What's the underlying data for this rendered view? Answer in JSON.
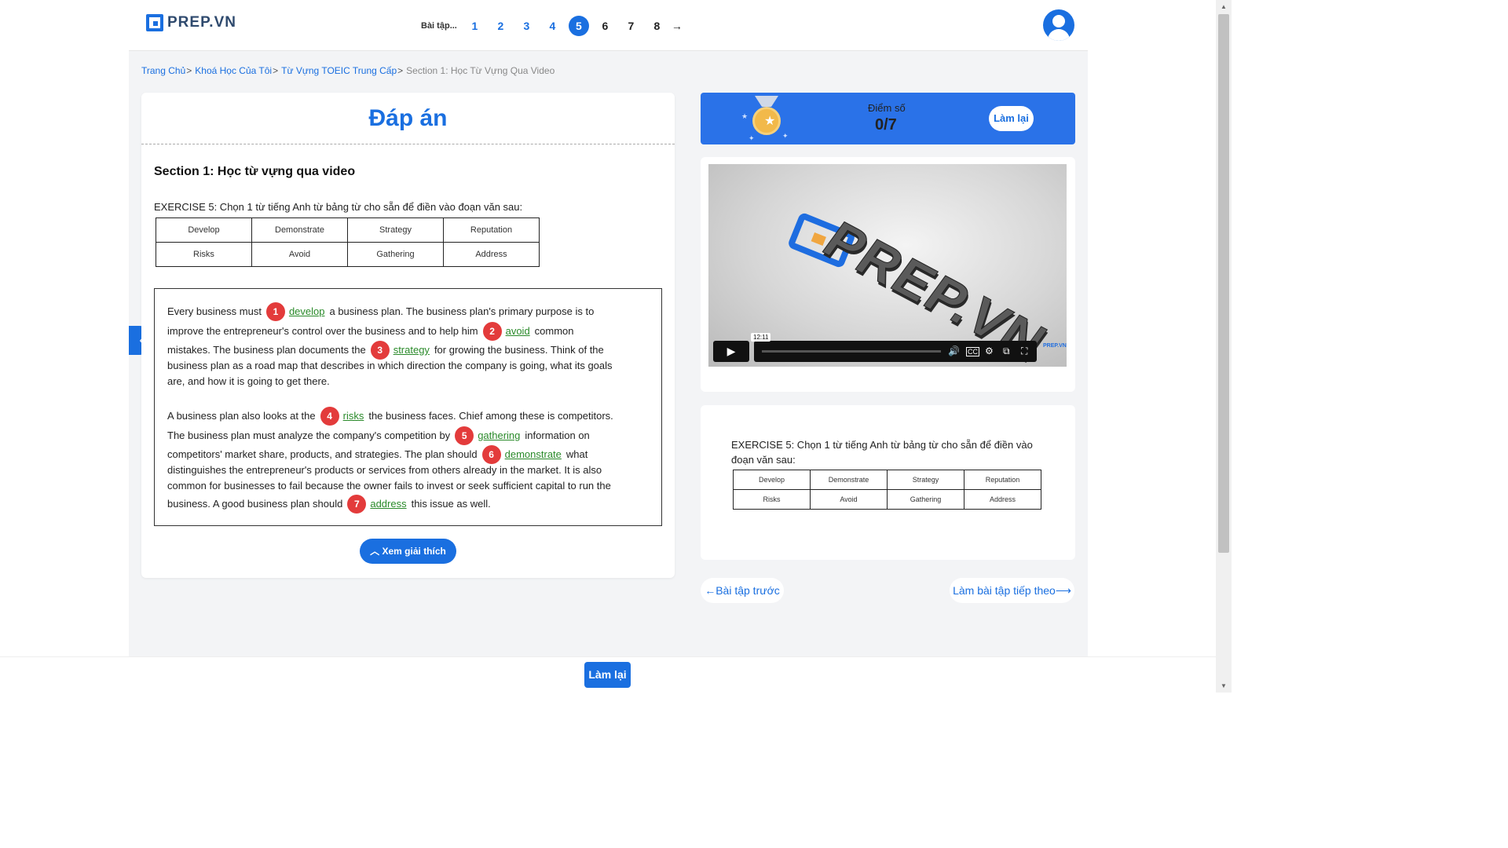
{
  "header": {
    "logo_text": "PREP.VN",
    "pager_label": "Bài tập",
    "pages": [
      "1",
      "2",
      "3",
      "4",
      "5",
      "6",
      "7",
      "8"
    ],
    "active_page": "5",
    "next_arrow": "→"
  },
  "breadcrumb": {
    "items": [
      "Trang Chủ",
      "Khoá Học Của Tôi",
      "Từ Vựng TOEIC Trung Cấp"
    ],
    "current": "Section 1: Học Từ Vựng Qua Video",
    "separator": ">"
  },
  "answer": {
    "heading": "Đáp án",
    "section_title": "Section 1: Học từ vựng qua video",
    "exercise_title": "EXERCISE 5: Chọn 1 từ tiếng Anh từ bảng từ cho sẵn để điền vào đoạn văn sau:",
    "word_table": [
      [
        "Develop",
        "Demonstrate",
        "Strategy",
        "Reputation"
      ],
      [
        "Risks",
        "Avoid",
        "Gathering",
        "Address"
      ]
    ],
    "lines": {
      "l1a": "Every business must",
      "b1": "1",
      "a1": "develop",
      "l1b": "a business plan. The business plan's primary purpose is to",
      "l2a": "improve the entrepreneur's control over the business and to help him",
      "b2": "2",
      "a2": "avoid",
      "l2b": "common",
      "l3a": "mistakes. The business plan documents the",
      "b3": "3",
      "a3": "strategy",
      "l3b": "for growing the business. Think of the",
      "l4": "business plan as a road map that describes in which direction the company is going, what its goals",
      "l5": "are, and how it is going to get there.",
      "l6a": "A business plan also looks at the",
      "b4": "4",
      "a4": "risks",
      "l6b": "the business faces. Chief among these is competitors.",
      "l7a": "The business plan must analyze the company's competition by",
      "b5": "5",
      "a5": "gathering",
      "l7b": "information on",
      "l8a": "competitors' market share, products, and strategies. The plan should",
      "b6": "6",
      "a6": "demonstrate",
      "l8b": "what",
      "l9": "distinguishes the entrepreneur's products or services from others already in the market. It is also",
      "l10": "common for businesses to fail because the owner fails to invest or seek sufficient capital to run the",
      "l11a": "business. A good business plan should",
      "b7": "7",
      "a7": "address",
      "l11b": "this issue as well."
    },
    "explain_button": "Xem giải thích"
  },
  "score": {
    "label": "Điểm số",
    "value": "0/7",
    "retry_label": "Làm lại"
  },
  "video": {
    "time_tooltip": "12:11",
    "watermark": "PREP.VN",
    "brand_text": "PREP.VN"
  },
  "exercise_panel": {
    "title": "EXERCISE 5: Chọn 1 từ tiếng Anh từ bảng từ cho sẵn để điền vào đoạn văn sau:",
    "word_table": [
      [
        "Develop",
        "Demonstrate",
        "Strategy",
        "Reputation"
      ],
      [
        "Risks",
        "Avoid",
        "Gathering",
        "Address"
      ]
    ]
  },
  "nav": {
    "prev_label": "←Bài tập trước",
    "next_label": "Làm bài tập tiếp theo⟶"
  },
  "bottom": {
    "retry_label": "Làm lại"
  },
  "colors": {
    "accent": "#1a6fe0",
    "answer_green": "#2a8a2a",
    "badge_red": "#e33b3b"
  }
}
